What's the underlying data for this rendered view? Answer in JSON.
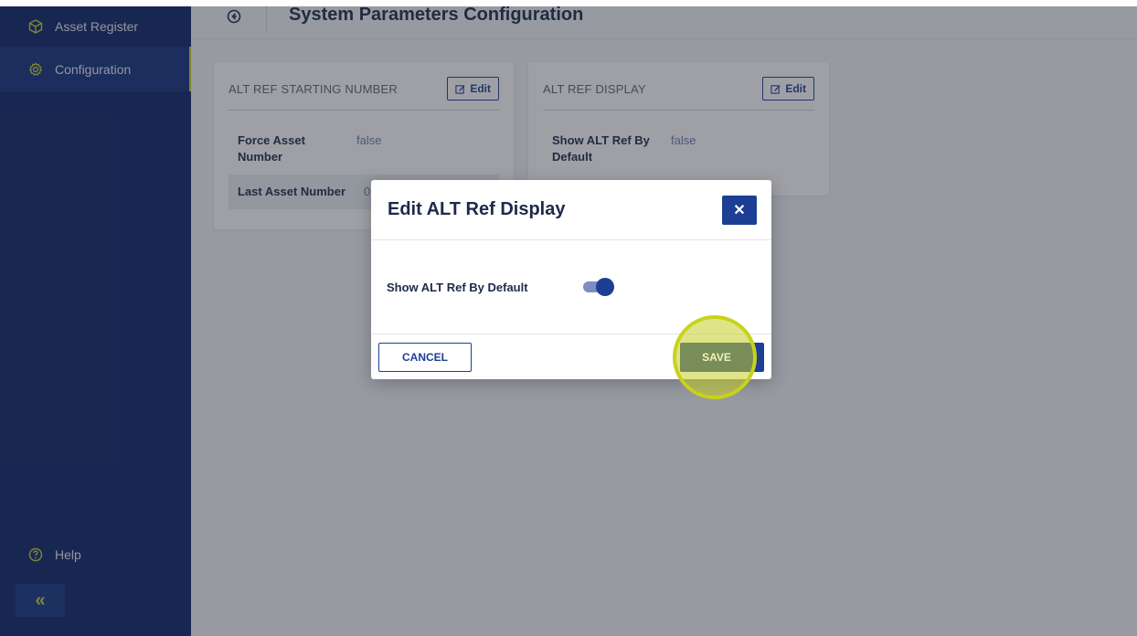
{
  "sidebar": {
    "items": [
      {
        "label": "Asset Register",
        "icon": "cube-icon"
      },
      {
        "label": "Configuration",
        "icon": "gear-icon"
      }
    ],
    "help_label": "Help",
    "collapse_label": "«"
  },
  "header": {
    "title": "System Parameters Configuration"
  },
  "cards": [
    {
      "title": "ALT REF STARTING NUMBER",
      "edit_label": "Edit",
      "rows": [
        {
          "key": "Force Asset Number",
          "value": "false"
        },
        {
          "key": "Last Asset Number",
          "value": "0"
        }
      ]
    },
    {
      "title": "ALT REF DISPLAY",
      "edit_label": "Edit",
      "rows": [
        {
          "key": "Show ALT Ref By Default",
          "value": "false"
        }
      ]
    }
  ],
  "modal": {
    "title": "Edit ALT Ref Display",
    "close_label": "✕",
    "toggle_label": "Show ALT Ref By Default",
    "toggle_on": true,
    "cancel_label": "CANCEL",
    "save_label": "SAVE"
  },
  "colors": {
    "sidebar_bg": "#0c2466",
    "primary": "#1c3f94",
    "accent": "#c7d327"
  }
}
